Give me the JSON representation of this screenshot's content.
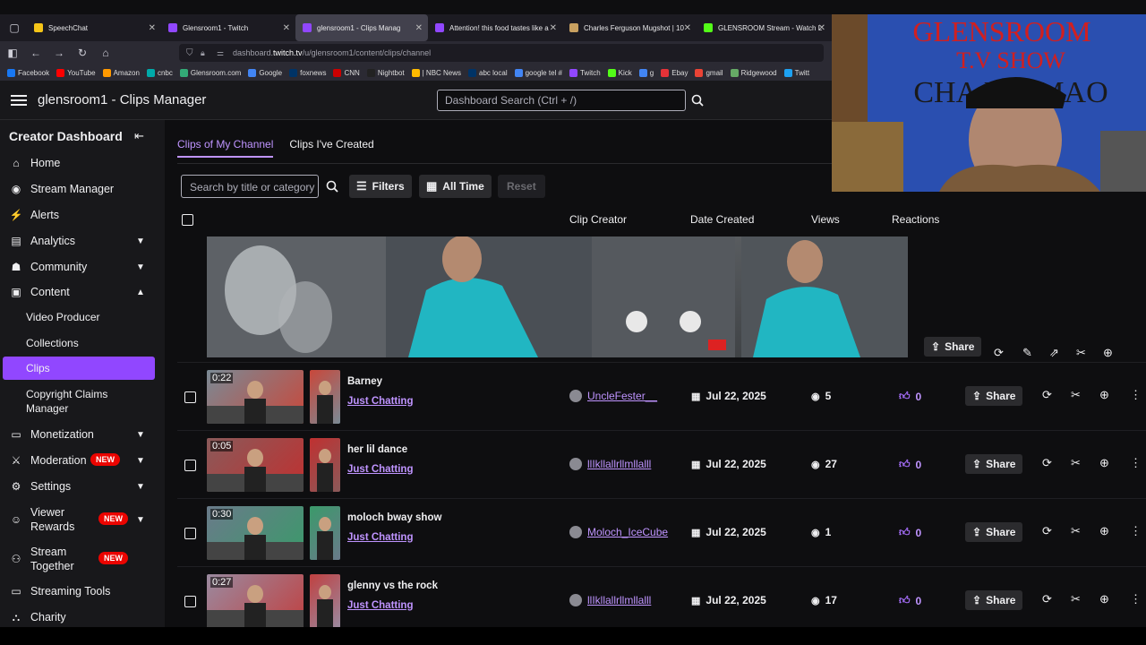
{
  "browser": {
    "tabs": [
      {
        "title": "SpeechChat",
        "color": "#f5c518"
      },
      {
        "title": "Glensroom1 - Twitch",
        "color": "#9147ff"
      },
      {
        "title": "glensroom1 - Clips Manag",
        "color": "#9147ff",
        "active": true
      },
      {
        "title": "Attention! this food tastes like a",
        "color": "#9147ff"
      },
      {
        "title": "Charles Ferguson Mugshot | 10",
        "color": "#c8a060"
      },
      {
        "title": "GLENSROOM Stream - Watch L",
        "color": "#53fc18"
      }
    ],
    "url_prefix": "dashboard.",
    "url_host": "twitch.tv",
    "url_path": "/u/glensroom1/content/clips/channel",
    "bookmarks": [
      "Facebook",
      "YouTube",
      "Amazon",
      "cnbc",
      "Glensroom.com",
      "Google",
      "foxnews",
      "CNN",
      "Nightbot",
      "| NBC News",
      "abc local",
      "google tel #",
      "Twitch",
      "Kick",
      "g",
      "Ebay",
      "gmail",
      "Ridgewood",
      "Twitt"
    ]
  },
  "header": {
    "title": "glensroom1 - Clips Manager",
    "search_placeholder": "Dashboard Search (Ctrl + /)"
  },
  "sidebar": {
    "title": "Creator Dashboard",
    "items": [
      {
        "label": "Home",
        "icon": "home-icon"
      },
      {
        "label": "Stream Manager",
        "icon": "stream-manager-icon"
      },
      {
        "label": "Alerts",
        "icon": "alerts-icon"
      },
      {
        "label": "Analytics",
        "icon": "analytics-icon"
      },
      {
        "label": "Community",
        "icon": "community-icon"
      },
      {
        "label": "Content",
        "icon": "content-icon"
      },
      {
        "label": "Monetization",
        "icon": "monetization-icon"
      },
      {
        "label": "Moderation",
        "icon": "moderation-icon",
        "badge": "NEW"
      },
      {
        "label": "Settings",
        "icon": "settings-icon"
      },
      {
        "label": "Viewer Rewards",
        "icon": "rewards-icon",
        "badge": "NEW"
      },
      {
        "label": "Stream Together",
        "icon": "stream-together-icon",
        "badge": "NEW"
      },
      {
        "label": "Streaming Tools",
        "icon": "tools-icon"
      },
      {
        "label": "Charity",
        "icon": "charity-icon"
      }
    ],
    "content_sub": [
      "Video Producer",
      "Collections",
      "Clips",
      "Copyright Claims Manager"
    ],
    "accent": "#9147ff"
  },
  "main": {
    "tabs": [
      "Clips of My Channel",
      "Clips I've Created"
    ],
    "filter_placeholder": "Search by title or category",
    "filters_label": "Filters",
    "time_label": "All Time",
    "reset_label": "Reset",
    "columns": [
      "Clip Creator",
      "Date Created",
      "Views",
      "Reactions"
    ],
    "share_label": "Share",
    "clips": [
      {
        "duration": "0:22",
        "title": "Barney",
        "category": "Just Chatting",
        "creator": "UncleFester__",
        "date": "Jul 22, 2025",
        "views": "5",
        "reactions": "0"
      },
      {
        "duration": "0:05",
        "title": "her lil dance",
        "category": "Just Chatting",
        "creator": "llIkllallrllmllalll",
        "date": "Jul 22, 2025",
        "views": "27",
        "reactions": "0"
      },
      {
        "duration": "0:30",
        "title": "moloch bway show",
        "category": "Just Chatting",
        "creator": "Moloch_IceCube",
        "date": "Jul 22, 2025",
        "views": "1",
        "reactions": "0"
      },
      {
        "duration": "0:27",
        "title": "glenny vs the rock",
        "category": "Just Chatting",
        "creator": "llIkllallrllmllalll",
        "date": "Jul 22, 2025",
        "views": "17",
        "reactions": "0"
      }
    ]
  },
  "webcam": {
    "banner_line1": "GLENSROOM",
    "banner_line2": "T.V SHOW",
    "banner_line3": "CHA M LMAO"
  }
}
